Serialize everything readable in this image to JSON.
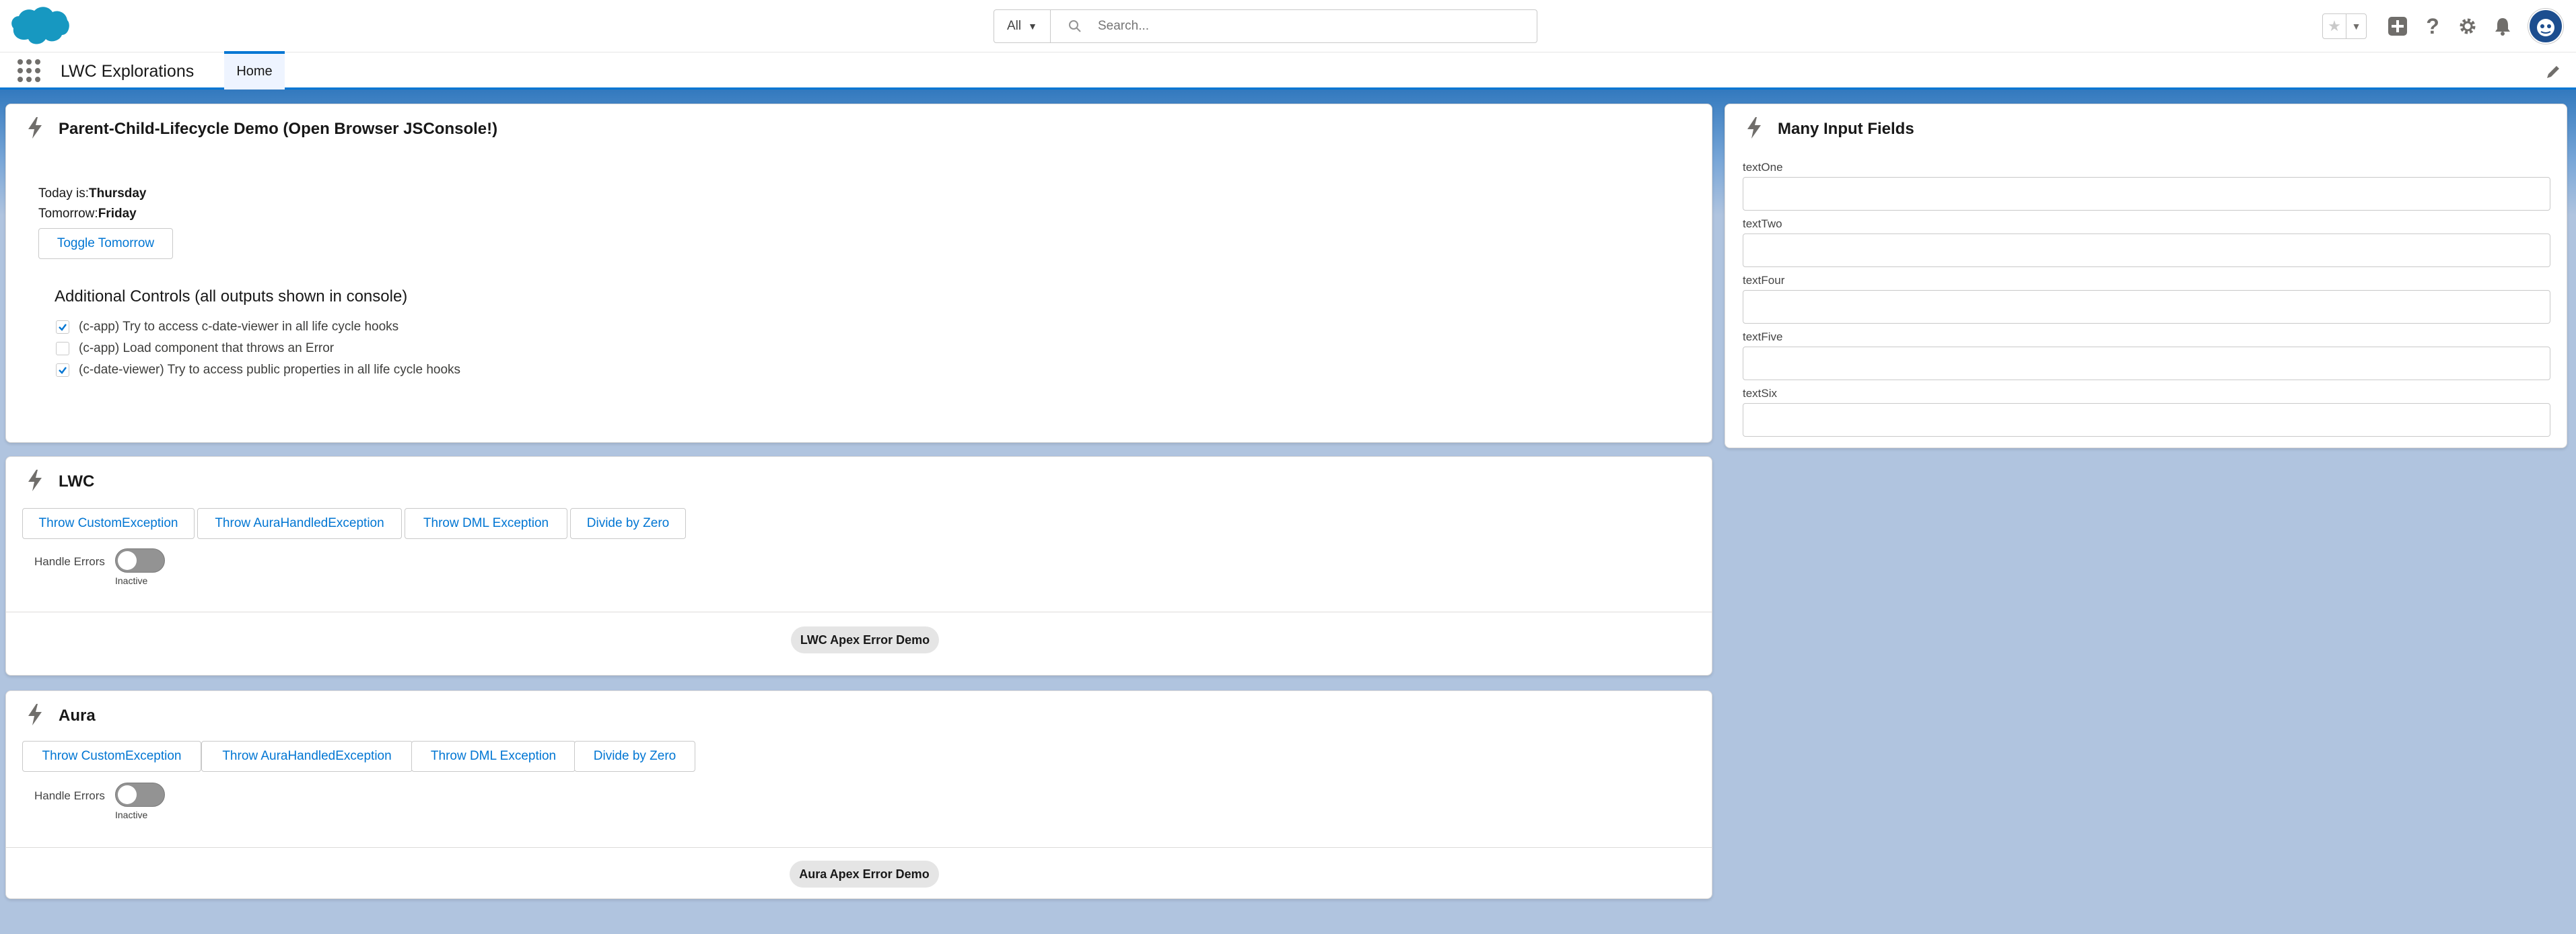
{
  "header": {
    "search_scope": "All",
    "search_placeholder": "Search..."
  },
  "nav": {
    "app_name": "LWC Explorations",
    "tabs": [
      {
        "label": "Home"
      }
    ]
  },
  "lifecycle_card": {
    "title": "Parent-Child-Lifecycle Demo (Open Browser JSConsole!)",
    "today_label": "Today is:",
    "today_value": "Thursday",
    "tomorrow_label": "Tomorrow:",
    "tomorrow_value": "Friday",
    "toggle_button": "Toggle Tomorrow",
    "additional_controls_title": "Additional Controls (all outputs shown in console)",
    "checkboxes": [
      {
        "label": "(c-app) Try to access c-date-viewer in all life cycle hooks",
        "checked": true
      },
      {
        "label": "(c-app) Load component that throws an Error",
        "checked": false
      },
      {
        "label": "(c-date-viewer) Try to access public properties in all life cycle hooks",
        "checked": true
      }
    ]
  },
  "inputs_card": {
    "title": "Many Input Fields",
    "fields": [
      {
        "label": "textOne",
        "value": ""
      },
      {
        "label": "textTwo",
        "value": ""
      },
      {
        "label": "textFour",
        "value": ""
      },
      {
        "label": "textFive",
        "value": ""
      },
      {
        "label": "textSix",
        "value": ""
      }
    ]
  },
  "lwc_card": {
    "title": "LWC",
    "buttons": [
      "Throw CustomException",
      "Throw AuraHandledException",
      "Throw DML Exception",
      "Divide by Zero"
    ],
    "toggle_label": "Handle Errors",
    "toggle_state": "Inactive",
    "footer_badge": "LWC Apex Error Demo"
  },
  "aura_card": {
    "title": "Aura",
    "buttons": [
      "Throw CustomException",
      "Throw AuraHandledException",
      "Throw DML Exception",
      "Divide by Zero"
    ],
    "toggle_label": "Handle Errors",
    "toggle_state": "Inactive",
    "footer_badge": "Aura Apex Error Demo"
  },
  "colors": {
    "brand": "#0176d3",
    "page_background": "#b0c4df"
  },
  "icons": [
    "salesforce-cloud-logo",
    "search-icon",
    "star-icon",
    "add-icon",
    "help-icon",
    "setup-gear-icon",
    "notification-bell-icon",
    "avatar",
    "app-launcher-icon",
    "edit-pencil-icon",
    "lightning-bolt-icon",
    "checkmark-icon"
  ]
}
